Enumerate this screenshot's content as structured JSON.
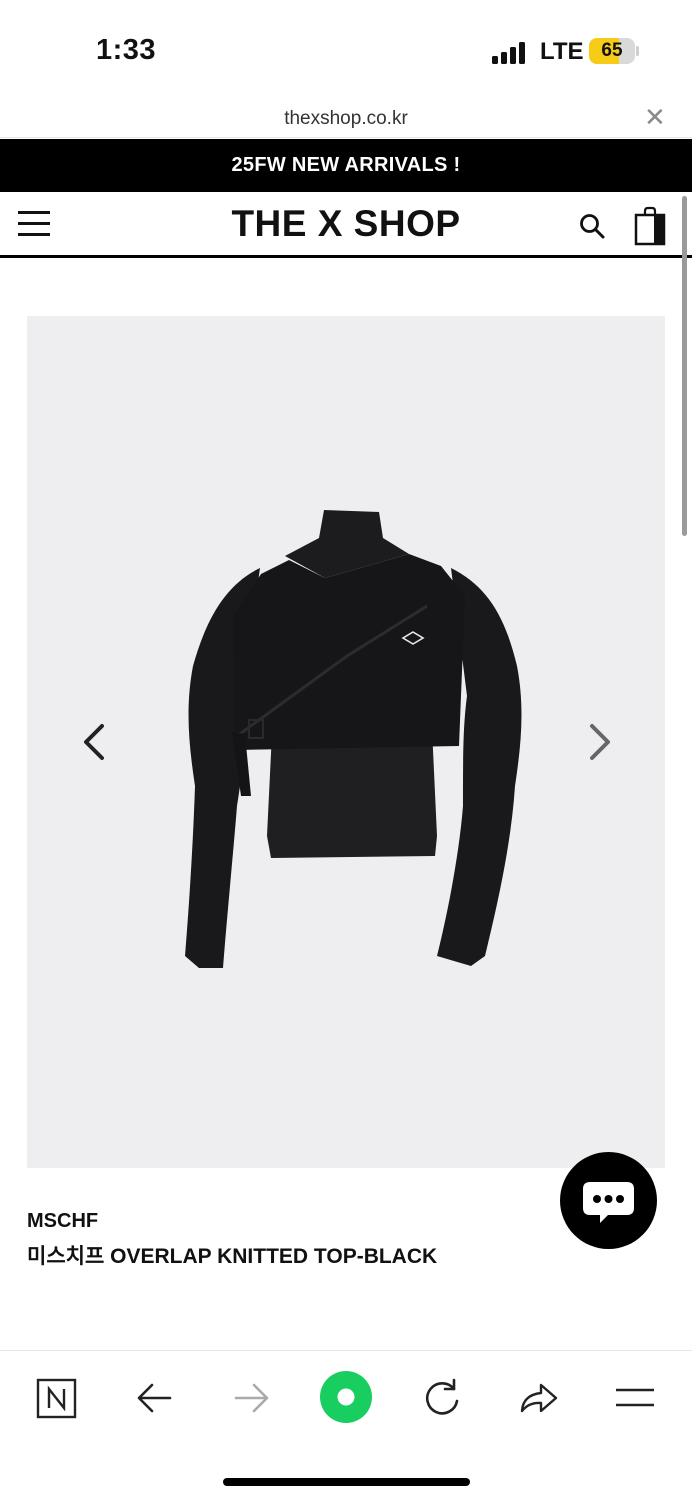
{
  "status_bar": {
    "time": "1:33",
    "network": "LTE",
    "battery": "65",
    "battery_level": 0.65
  },
  "url_bar": {
    "url": "thexshop.co.kr",
    "close_icon": "close-icon"
  },
  "announcement": {
    "text": "25FW NEW ARRIVALS !"
  },
  "header": {
    "logo": "THE X SHOP",
    "icons": [
      "menu-icon",
      "search-icon",
      "shopping-bag-icon"
    ]
  },
  "product": {
    "brand": "MSCHF",
    "name": "미스치프 OVERLAP KNITTED TOP-BLACK",
    "image_icon": "product-photo",
    "nav_icons": [
      "chevron-left-icon",
      "chevron-right-icon"
    ]
  },
  "chat": {
    "icon": "chat-bubble-icon"
  },
  "toolbar": {
    "icons": [
      "naver-icon",
      "back-arrow-icon",
      "forward-arrow-icon",
      "naver-green-dot-icon",
      "reload-icon",
      "share-icon",
      "hamburger-menu-icon"
    ]
  },
  "colors": {
    "announcement_bg": "#000000",
    "image_bg": "#eeeef0",
    "naver_green": "#19ce60",
    "battery_yellow": "#f7cc16"
  }
}
